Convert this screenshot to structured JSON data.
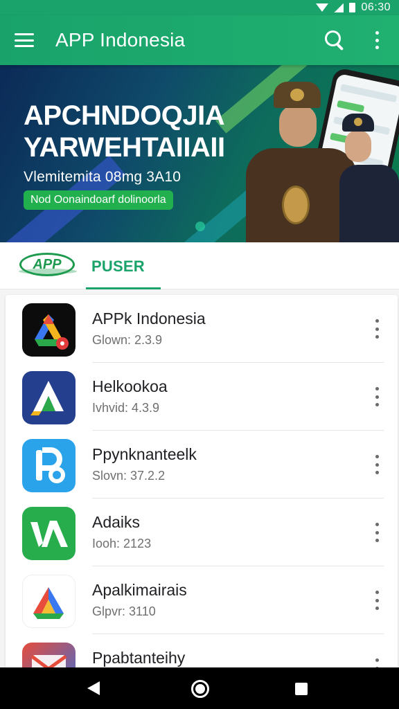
{
  "status_bar": {
    "time": "06:30"
  },
  "app_bar": {
    "title": "APP Indonesia"
  },
  "banner": {
    "headline_line1": "APCHNDOQJIA",
    "headline_line2": "YARWEHTAIIAII",
    "subtitle": "Vlemitemita 08mg 3A10",
    "cta": "Nod Oonaindoarf dolinoorla"
  },
  "tabs": {
    "logo_text": "APP",
    "active_label": "PUSER"
  },
  "apps": [
    {
      "name": "APPk Indonesia",
      "meta": "Glown: 2.3.9",
      "icon": "drive-style-icon",
      "bg": "#0c0c0c"
    },
    {
      "name": "Helkookoa",
      "meta": "Ivhvid: 4.3.9",
      "icon": "triangle-a-icon",
      "bg": "#243f8e"
    },
    {
      "name": "Ppynknanteelk",
      "meta": "Slovn: 37.2.2",
      "icon": "letter-p-icon",
      "bg": "#2ba3ea"
    },
    {
      "name": "Adaiks",
      "meta": "Iooh: 2123",
      "icon": "letter-va-icon",
      "bg": "#28ad4d"
    },
    {
      "name": "Apalkimairais",
      "meta": "Glpvr: 3110",
      "icon": "triangle-icon",
      "bg": "#ffffff"
    },
    {
      "name": "Ppabtanteihy",
      "meta": "",
      "icon": "envelope-icon",
      "bg": "#e64c3c"
    }
  ],
  "colors": {
    "primary": "#1aa36a",
    "banner_dark": "#0b2a57"
  }
}
